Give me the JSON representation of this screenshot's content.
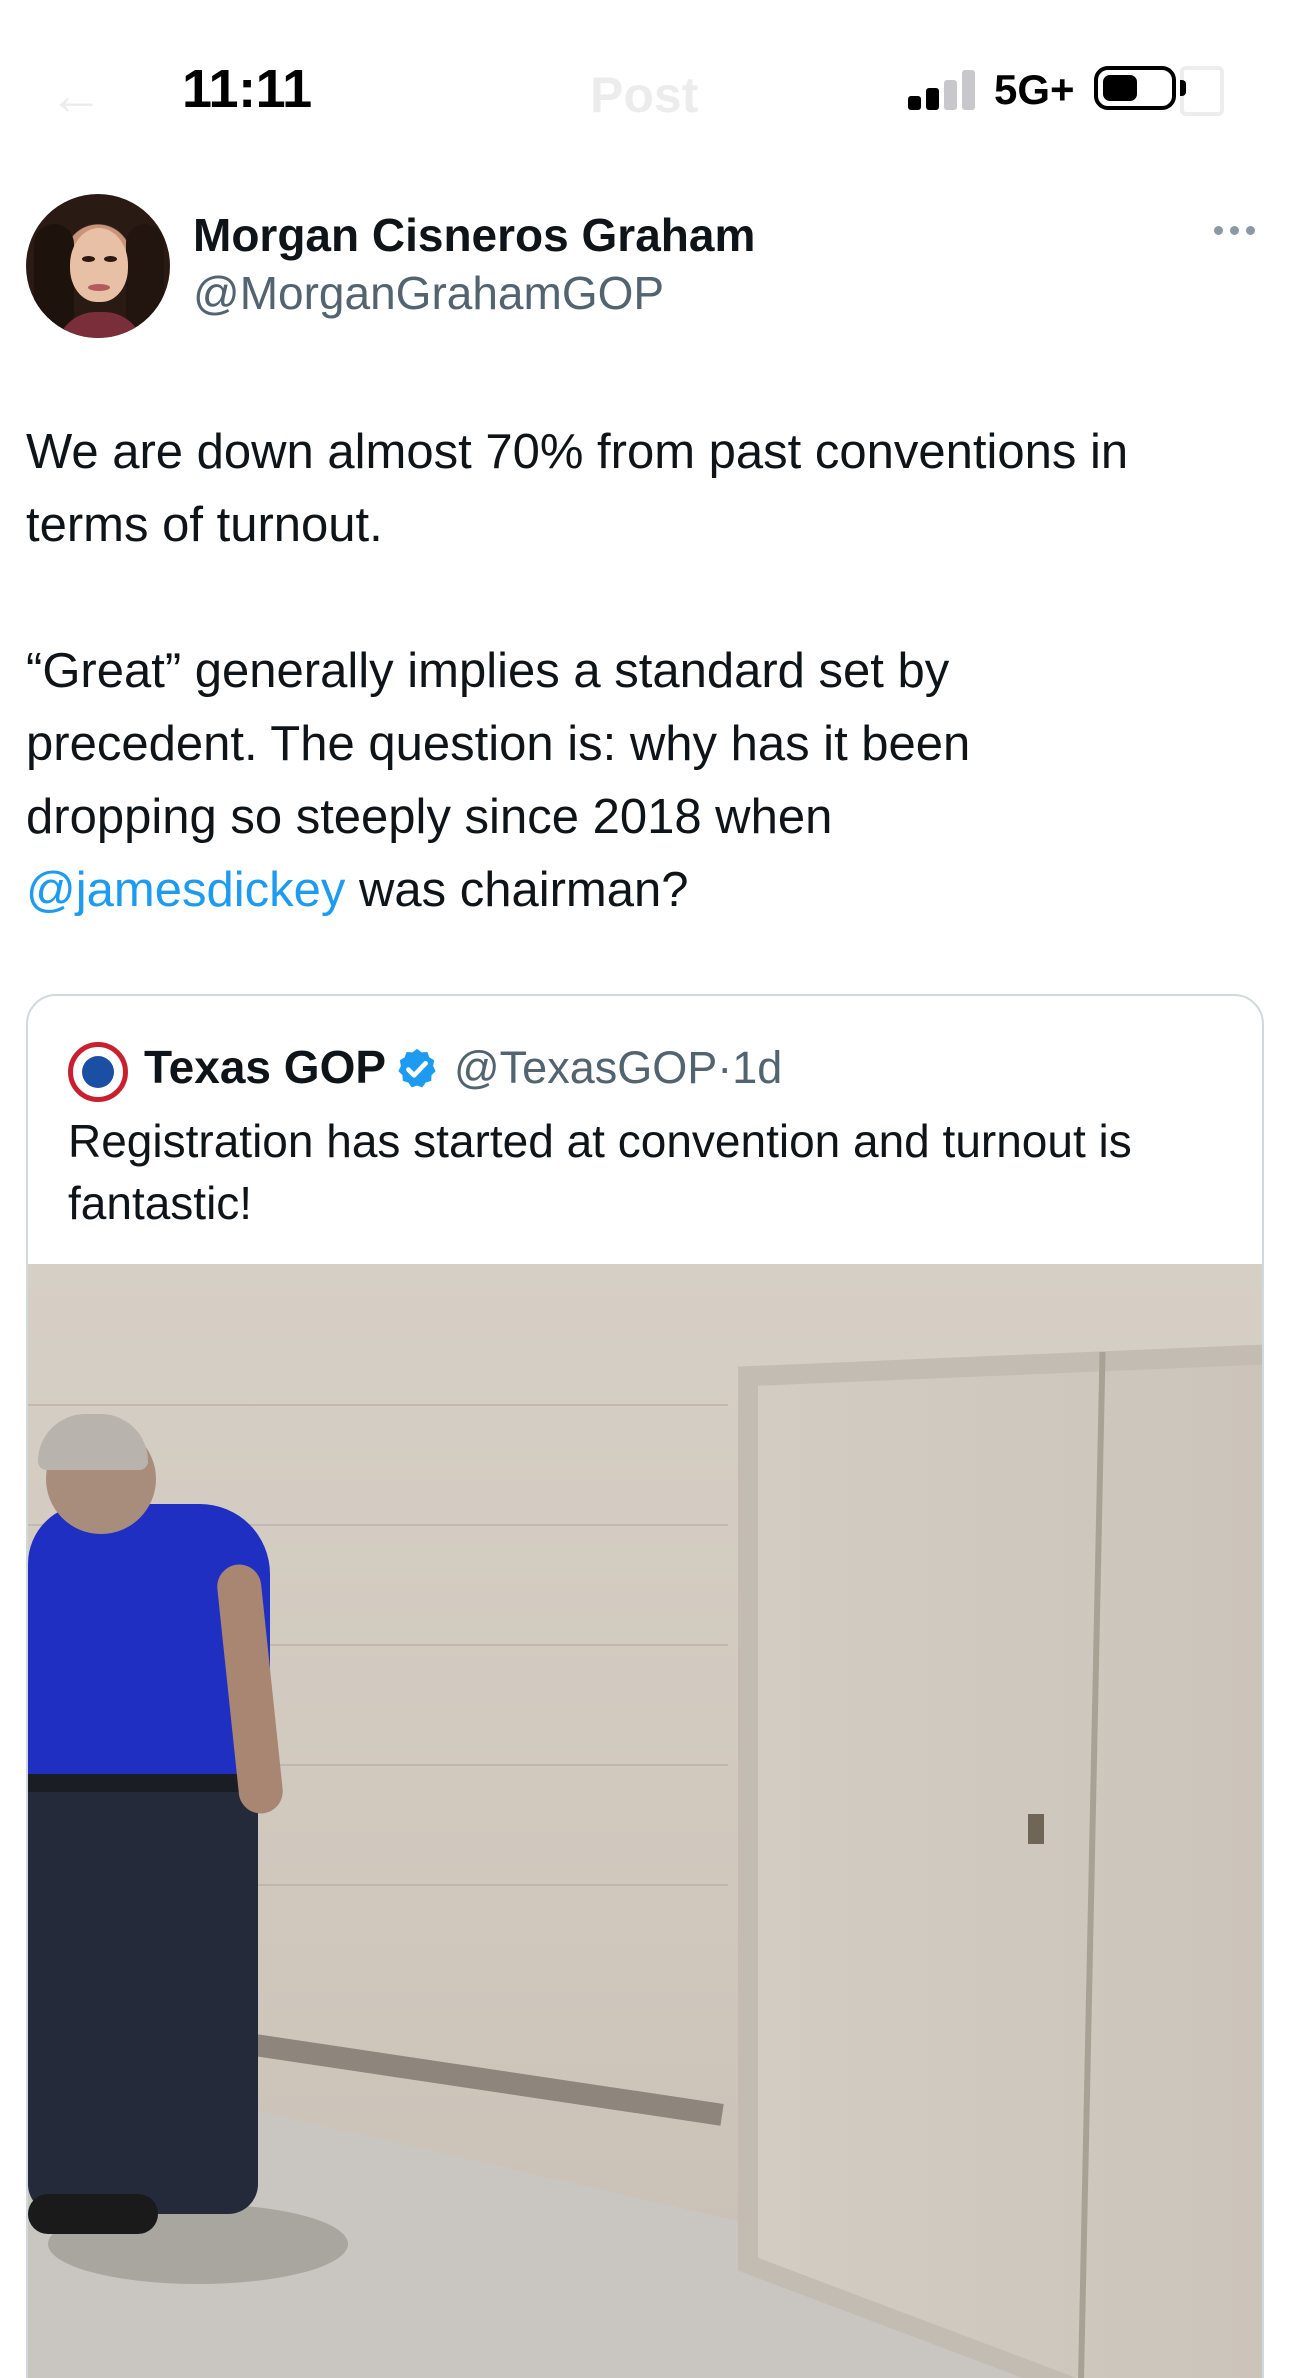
{
  "status_bar": {
    "time": "11:11",
    "network": "5G+",
    "signal_bars_filled": 2,
    "signal_bars_total": 4
  },
  "nav": {
    "back_icon": "arrow-left-icon",
    "title": "Post"
  },
  "post": {
    "author_name": "Morgan Cisneros Graham",
    "author_handle": "@MorganGrahamGOP",
    "text_lines": [
      "We are down almost 70% from past conventions in",
      "terms of turnout."
    ],
    "text_lines_2": [
      "“Great” generally implies a standard set by",
      "precedent. The question is: why has it been",
      "dropping so steeply since 2018 when"
    ],
    "mention": "@jamesdickey",
    "mention_suffix": " was chairman?"
  },
  "quoted_post": {
    "author_name": "Texas GOP",
    "author_handle": "@TexasGOP",
    "separator": "·",
    "age": "1d",
    "text": "Registration has started at convention and turnout is fantastic!",
    "verified": true
  },
  "colors": {
    "link": "#1d9bf0",
    "secondary_text": "#536471",
    "border": "#cfd9de",
    "verified": "#1d9bf0"
  }
}
